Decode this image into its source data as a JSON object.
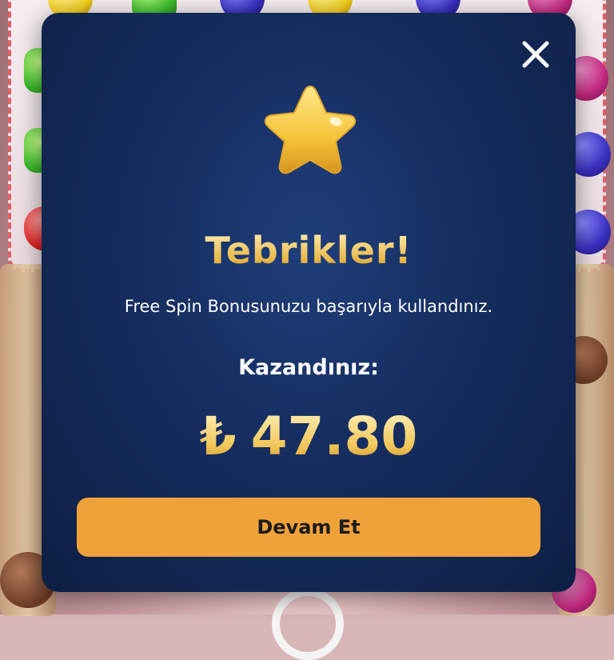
{
  "modal": {
    "title": "Tebrikler!",
    "message": "Free Spin Bonusunuzu başarıyla kullandınız.",
    "win_label": "Kazandınız:",
    "currency_symbol": "₺",
    "amount": "47.80",
    "continue_label": "Devam Et",
    "close_icon": "close-icon",
    "star_icon": "star-icon"
  },
  "colors": {
    "modal_background": "#152d5e",
    "accent_gold": "#f3d27c",
    "button": "#f0a23a"
  }
}
